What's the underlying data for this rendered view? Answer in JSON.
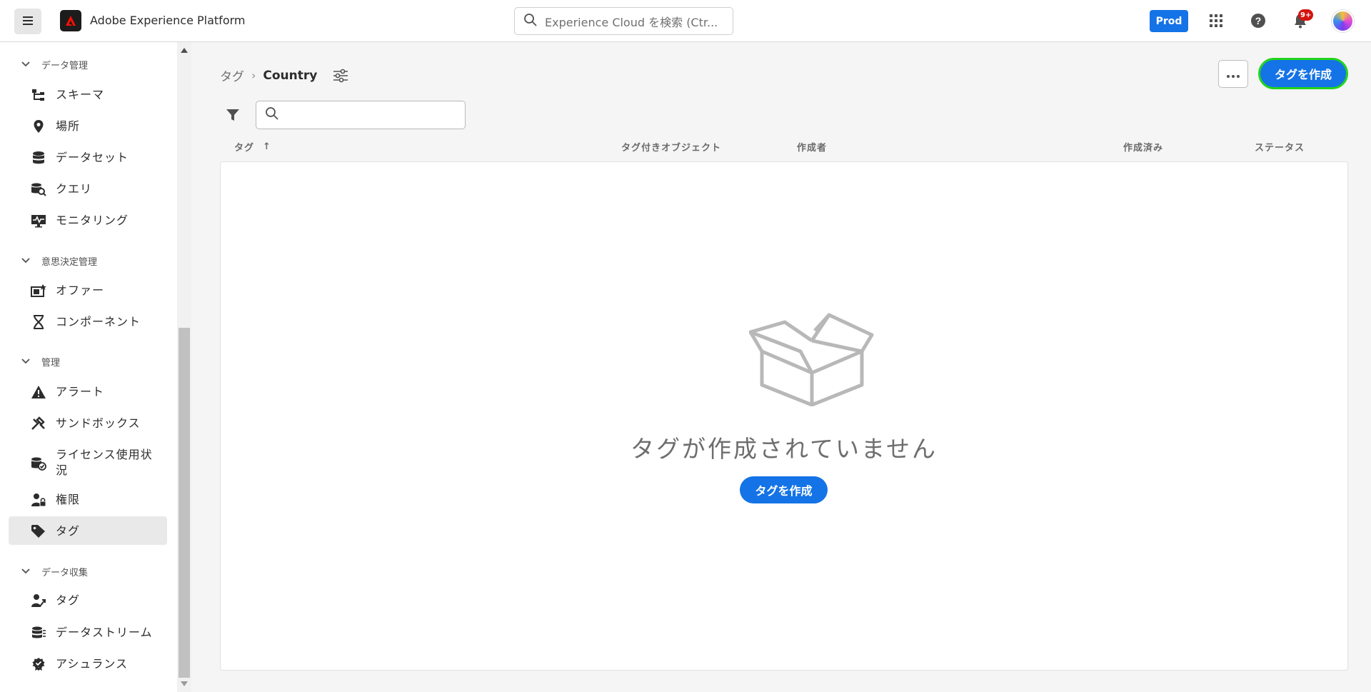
{
  "app": {
    "name": "Adobe Experience Platform",
    "search_placeholder": "Experience Cloud を検索 (Ctr...",
    "sandbox_badge": "Prod",
    "notification_count": "9+"
  },
  "sidebar": {
    "sections": [
      {
        "title": "データ管理",
        "items": [
          {
            "label": "スキーマ",
            "icon": "schema-icon"
          },
          {
            "label": "場所",
            "icon": "location-pin-icon"
          },
          {
            "label": "データセット",
            "icon": "database-icon"
          },
          {
            "label": "クエリ",
            "icon": "query-icon"
          },
          {
            "label": "モニタリング",
            "icon": "monitoring-icon"
          }
        ]
      },
      {
        "title": "意思決定管理",
        "items": [
          {
            "label": "オファー",
            "icon": "offer-icon"
          },
          {
            "label": "コンポーネント",
            "icon": "components-icon"
          }
        ]
      },
      {
        "title": "管理",
        "items": [
          {
            "label": "アラート",
            "icon": "alert-icon"
          },
          {
            "label": "サンドボックス",
            "icon": "sandbox-icon"
          },
          {
            "label": "ライセンス使用状況",
            "icon": "license-icon"
          },
          {
            "label": "権限",
            "icon": "permissions-icon"
          },
          {
            "label": "タグ",
            "icon": "tag-icon",
            "active": true
          }
        ]
      },
      {
        "title": "データ収集",
        "items": [
          {
            "label": "タグ",
            "icon": "tags-launch-icon"
          },
          {
            "label": "データストリーム",
            "icon": "datastream-icon"
          },
          {
            "label": "アシュランス",
            "icon": "assurance-icon"
          }
        ]
      }
    ]
  },
  "main": {
    "breadcrumb": {
      "parent": "タグ",
      "current": "Country"
    },
    "create_button": "タグを作成",
    "table": {
      "columns": [
        "タグ",
        "タグ付きオブジェクト",
        "作成者",
        "作成済み",
        "ステータス"
      ],
      "sort_indicator": "↑"
    },
    "empty_state": {
      "message": "タグが作成されていません",
      "button": "タグを作成"
    }
  },
  "colors": {
    "accent": "#1473e6",
    "highlight_outline": "#22d41e",
    "notification": "#d31510"
  }
}
